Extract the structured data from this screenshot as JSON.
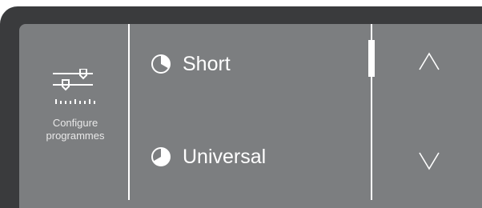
{
  "sidebar": {
    "configure_icon": "sliders-icon",
    "configure_label_line1": "Configure",
    "configure_label_line2": "programmes"
  },
  "programmes": [
    {
      "label": "Short",
      "icon": "pie-short-icon"
    },
    {
      "label": "Universal",
      "icon": "pie-universal-icon"
    }
  ],
  "navigation": {
    "up_icon": "chevron-up-icon",
    "down_icon": "chevron-down-icon"
  },
  "colors": {
    "bezel": "#3a3b3d",
    "screen": "#7c7e80",
    "foreground": "#ffffff"
  }
}
